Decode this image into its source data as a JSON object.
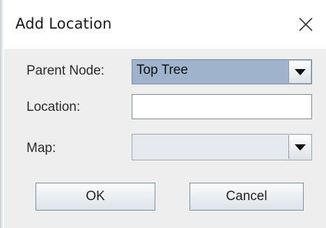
{
  "dialog": {
    "title": "Add Location",
    "close_icon": "close-icon"
  },
  "form": {
    "parent_node": {
      "label": "Parent Node:",
      "value": "Top Tree"
    },
    "location": {
      "label": "Location:",
      "value": ""
    },
    "map": {
      "label": "Map:",
      "value": ""
    }
  },
  "buttons": {
    "ok_label": "OK",
    "cancel_label": "Cancel"
  },
  "colors": {
    "selected_combo_bg": "#9fb4cc",
    "disabled_combo_bg": "#e6eaee",
    "panel_bg": "#eeeeee"
  },
  "icons": {
    "dropdown": "chevron-down-icon"
  }
}
